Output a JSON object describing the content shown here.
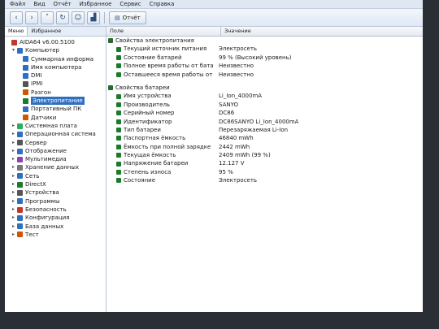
{
  "menubar": [
    "Файл",
    "Вид",
    "Отчёт",
    "Избранное",
    "Сервис",
    "Справка"
  ],
  "toolbar": {
    "report_label": "Отчёт"
  },
  "left": {
    "tabs": [
      "Меню",
      "Избранное"
    ],
    "tree": [
      {
        "label": "AIDA64 v6.00.5100",
        "indent": 0,
        "color": "#c0392b"
      },
      {
        "label": "Компьютер",
        "indent": 1,
        "color": "#2f6fc0",
        "arrow": "▾"
      },
      {
        "label": "Суммарная информа",
        "indent": 2,
        "color": "#2f6fc0"
      },
      {
        "label": "Имя компьютера",
        "indent": 2,
        "color": "#2f6fc0"
      },
      {
        "label": "DMI",
        "indent": 2,
        "color": "#2f6fc0"
      },
      {
        "label": "IPMI",
        "indent": 2,
        "color": "#555"
      },
      {
        "label": "Разгон",
        "indent": 2,
        "color": "#d35400"
      },
      {
        "label": "Электропитание",
        "indent": 2,
        "color": "#1a7b2a",
        "sel": true
      },
      {
        "label": "Портативный ПК",
        "indent": 2,
        "color": "#2f6fc0"
      },
      {
        "label": "Датчики",
        "indent": 2,
        "color": "#d35400"
      },
      {
        "label": "Системная плата",
        "indent": 1,
        "color": "#27ae60",
        "arrow": "▸"
      },
      {
        "label": "Операционная система",
        "indent": 1,
        "color": "#2f6fc0",
        "arrow": "▸"
      },
      {
        "label": "Сервер",
        "indent": 1,
        "color": "#555",
        "arrow": "▸"
      },
      {
        "label": "Отображение",
        "indent": 1,
        "color": "#2f6fc0",
        "arrow": "▸"
      },
      {
        "label": "Мультимедиа",
        "indent": 1,
        "color": "#8e44ad",
        "arrow": "▸"
      },
      {
        "label": "Хранение данных",
        "indent": 1,
        "color": "#777",
        "arrow": "▸"
      },
      {
        "label": "Сеть",
        "indent": 1,
        "color": "#2f6fc0",
        "arrow": "▸"
      },
      {
        "label": "DirectX",
        "indent": 1,
        "color": "#1a7b2a",
        "arrow": "▸"
      },
      {
        "label": "Устройства",
        "indent": 1,
        "color": "#555",
        "arrow": "▸"
      },
      {
        "label": "Программы",
        "indent": 1,
        "color": "#2f6fc0",
        "arrow": "▸"
      },
      {
        "label": "Безопасность",
        "indent": 1,
        "color": "#c0392b",
        "arrow": "▸"
      },
      {
        "label": "Конфигурация",
        "indent": 1,
        "color": "#2f6fc0",
        "arrow": "▸"
      },
      {
        "label": "База данных",
        "indent": 1,
        "color": "#2f6fc0",
        "arrow": "▸"
      },
      {
        "label": "Тест",
        "indent": 1,
        "color": "#d35400",
        "arrow": "▸"
      }
    ]
  },
  "right": {
    "col_field": "Поле",
    "col_value": "Значение",
    "sections": [
      {
        "title": "Свойства электропитания",
        "rows": [
          {
            "field": "Текущий источник питания",
            "value": "Электросеть"
          },
          {
            "field": "Состояние батарей",
            "value": "99 % (Высокий уровень)"
          },
          {
            "field": "Полное время работы от бата...",
            "value": "Неизвестно"
          },
          {
            "field": "Оставшееся время работы от ...",
            "value": "Неизвестно"
          }
        ]
      },
      {
        "title": "Свойства батареи",
        "rows": [
          {
            "field": "Имя устройства",
            "value": "Li_Ion_4000mA"
          },
          {
            "field": "Производитель",
            "value": "SANYO"
          },
          {
            "field": "Серийный номер",
            "value": "DC86"
          },
          {
            "field": "Идентификатор",
            "value": "DC86SANYO Li_Ion_4000mA"
          },
          {
            "field": "Тип батареи",
            "value": "Перезаряжаемая Li-Ion"
          },
          {
            "field": "Паспортная ёмкость",
            "value": "46840 mWh"
          },
          {
            "field": "Ёмкость при полной зарядке",
            "value": "2442 mWh"
          },
          {
            "field": "Текущая ёмкость",
            "value": "2409 mWh (99 %)"
          },
          {
            "field": "Напряжение батареи",
            "value": "12.127 V"
          },
          {
            "field": "Степень износа",
            "value": "95 %"
          },
          {
            "field": "Состояние",
            "value": "Электросеть"
          }
        ]
      }
    ]
  }
}
